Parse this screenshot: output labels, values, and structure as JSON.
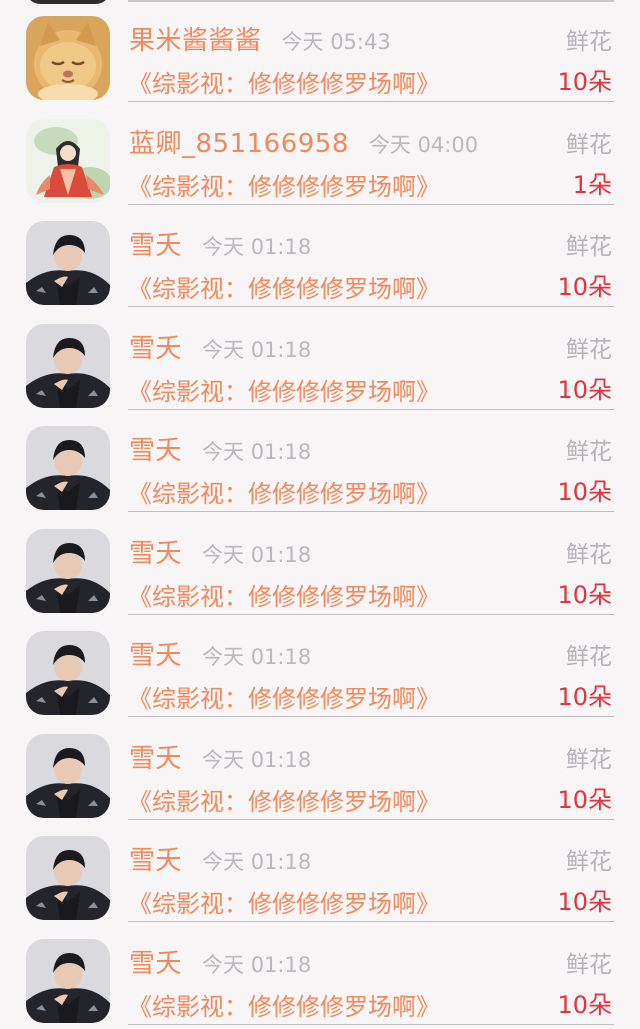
{
  "rows": [
    {
      "name": "果米酱酱酱",
      "time": "今天 05:43",
      "gift_type": "鲜花",
      "work_title": "《综影视：修修修修罗场啊》",
      "gift_count": "10朵",
      "avatar_icon": "kitten-avatar"
    },
    {
      "name": "蓝卿_851166958",
      "time": "今天 04:00",
      "gift_type": "鲜花",
      "work_title": "《综影视：修修修修罗场啊》",
      "gift_count": "1朵",
      "avatar_icon": "illustrated-lady-avatar"
    },
    {
      "name": "雪夭",
      "time": "今天 01:18",
      "gift_type": "鲜花",
      "work_title": "《综影视：修修修修罗场啊》",
      "gift_count": "10朵",
      "avatar_icon": "man-portrait-avatar"
    },
    {
      "name": "雪夭",
      "time": "今天 01:18",
      "gift_type": "鲜花",
      "work_title": "《综影视：修修修修罗场啊》",
      "gift_count": "10朵",
      "avatar_icon": "man-portrait-avatar"
    },
    {
      "name": "雪夭",
      "time": "今天 01:18",
      "gift_type": "鲜花",
      "work_title": "《综影视：修修修修罗场啊》",
      "gift_count": "10朵",
      "avatar_icon": "man-portrait-avatar"
    },
    {
      "name": "雪夭",
      "time": "今天 01:18",
      "gift_type": "鲜花",
      "work_title": "《综影视：修修修修罗场啊》",
      "gift_count": "10朵",
      "avatar_icon": "man-portrait-avatar"
    },
    {
      "name": "雪夭",
      "time": "今天 01:18",
      "gift_type": "鲜花",
      "work_title": "《综影视：修修修修罗场啊》",
      "gift_count": "10朵",
      "avatar_icon": "man-portrait-avatar"
    },
    {
      "name": "雪夭",
      "time": "今天 01:18",
      "gift_type": "鲜花",
      "work_title": "《综影视：修修修修罗场啊》",
      "gift_count": "10朵",
      "avatar_icon": "man-portrait-avatar"
    },
    {
      "name": "雪夭",
      "time": "今天 01:18",
      "gift_type": "鲜花",
      "work_title": "《综影视：修修修修罗场啊》",
      "gift_count": "10朵",
      "avatar_icon": "man-portrait-avatar"
    },
    {
      "name": "雪夭",
      "time": "今天 01:18",
      "gift_type": "鲜花",
      "work_title": "《综影视：修修修修罗场啊》",
      "gift_count": "10朵",
      "avatar_icon": "man-portrait-avatar"
    }
  ],
  "colors": {
    "name": "#f08a5d",
    "work_title": "#f08a5d",
    "gift_count": "#e0343e",
    "muted": "#b4b4b8",
    "background": "#f7f5f6"
  }
}
